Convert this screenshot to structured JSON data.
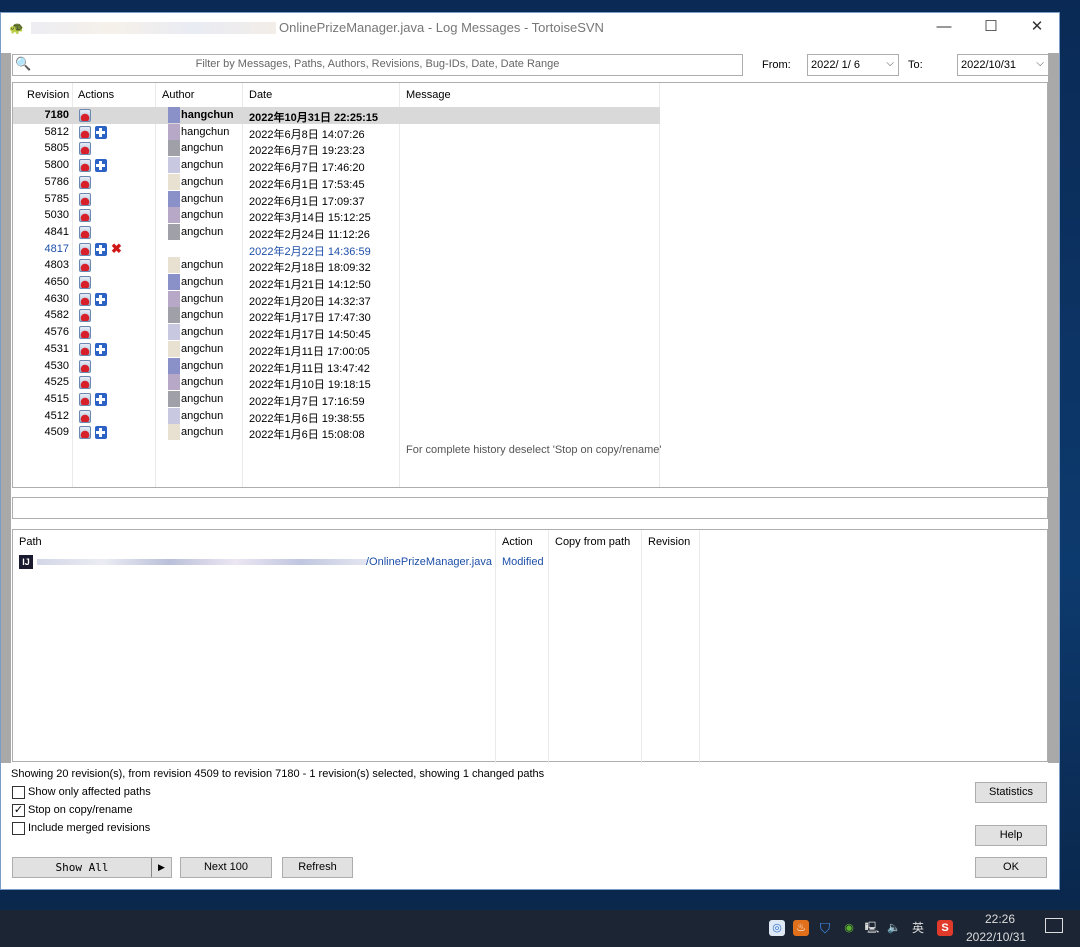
{
  "window": {
    "title": "OnlinePrizeManager.java - Log Messages - TortoiseSVN",
    "controls": {
      "minimize": "—",
      "maximize": "☐",
      "close": "✕"
    }
  },
  "filter": {
    "placeholder": "Filter by Messages, Paths, Authors, Revisions, Bug-IDs, Date, Date Range",
    "from_label": "From:",
    "from_value": "2022/ 1/ 6",
    "to_label": "To:",
    "to_value": "2022/10/31"
  },
  "log": {
    "columns": [
      "Revision",
      "Actions",
      "Author",
      "Date",
      "Message"
    ],
    "rows": [
      {
        "revision": "7180",
        "actions": [
          "modified"
        ],
        "author": "hangchun",
        "date": "2022年10月31日 22:25:15",
        "selected": true
      },
      {
        "revision": "5812",
        "actions": [
          "modified",
          "added"
        ],
        "author": "hangchun",
        "date": "2022年6月8日 14:07:26"
      },
      {
        "revision": "5805",
        "actions": [
          "modified"
        ],
        "author": "angchun",
        "date": "2022年6月7日 19:23:23"
      },
      {
        "revision": "5800",
        "actions": [
          "modified",
          "added"
        ],
        "author": "angchun",
        "date": "2022年6月7日 17:46:20"
      },
      {
        "revision": "5786",
        "actions": [
          "modified"
        ],
        "author": "angchun",
        "date": "2022年6月1日 17:53:45"
      },
      {
        "revision": "5785",
        "actions": [
          "modified"
        ],
        "author": "angchun",
        "date": "2022年6月1日 17:09:37"
      },
      {
        "revision": "5030",
        "actions": [
          "modified"
        ],
        "author": "angchun",
        "date": "2022年3月14日 15:12:25"
      },
      {
        "revision": "4841",
        "actions": [
          "modified"
        ],
        "author": "angchun",
        "date": "2022年2月24日 11:12:26"
      },
      {
        "revision": "4817",
        "actions": [
          "modified",
          "added",
          "deleted"
        ],
        "author": "",
        "date": "2022年2月22日 14:36:59",
        "highlight": true
      },
      {
        "revision": "4803",
        "actions": [
          "modified"
        ],
        "author": "angchun",
        "date": "2022年2月18日 18:09:32"
      },
      {
        "revision": "4650",
        "actions": [
          "modified"
        ],
        "author": "angchun",
        "date": "2022年1月21日 14:12:50"
      },
      {
        "revision": "4630",
        "actions": [
          "modified",
          "added"
        ],
        "author": "angchun",
        "date": "2022年1月20日 14:32:37"
      },
      {
        "revision": "4582",
        "actions": [
          "modified"
        ],
        "author": "angchun",
        "date": "2022年1月17日 17:47:30"
      },
      {
        "revision": "4576",
        "actions": [
          "modified"
        ],
        "author": "angchun",
        "date": "2022年1月17日 14:50:45"
      },
      {
        "revision": "4531",
        "actions": [
          "modified",
          "added"
        ],
        "author": "angchun",
        "date": "2022年1月11日 17:00:05"
      },
      {
        "revision": "4530",
        "actions": [
          "modified"
        ],
        "author": "angchun",
        "date": "2022年1月11日 13:47:42"
      },
      {
        "revision": "4525",
        "actions": [
          "modified"
        ],
        "author": "angchun",
        "date": "2022年1月10日 19:18:15"
      },
      {
        "revision": "4515",
        "actions": [
          "modified",
          "added"
        ],
        "author": "angchun",
        "date": "2022年1月7日 17:16:59"
      },
      {
        "revision": "4512",
        "actions": [
          "modified"
        ],
        "author": "angchun",
        "date": "2022年1月6日 19:38:55"
      },
      {
        "revision": "4509",
        "actions": [
          "modified",
          "added"
        ],
        "author": "angchun",
        "date": "2022年1月6日 15:08:08"
      }
    ],
    "note": "For complete history deselect 'Stop on copy/rename'"
  },
  "paths": {
    "columns": [
      "Path",
      "Action",
      "Copy from path",
      "Revision"
    ],
    "rows": [
      {
        "path": "/OnlinePrizeManager.java",
        "action": "Modified"
      }
    ]
  },
  "status": "Showing 20 revision(s), from revision 4509 to revision 7180 - 1 revision(s) selected, showing 1 changed paths",
  "options": [
    {
      "label": "Show only affected paths",
      "checked": false
    },
    {
      "label": "Stop on copy/rename",
      "checked": true
    },
    {
      "label": "Include merged revisions",
      "checked": false
    }
  ],
  "buttons": {
    "show_all": "Show All",
    "next": "Next 100",
    "refresh": "Refresh",
    "statistics": "Statistics",
    "help": "Help",
    "ok": "OK"
  },
  "taskbar": {
    "time": "22:26",
    "date": "2022/10/31",
    "ime": "英",
    "sogou": "S"
  },
  "colors": {
    "selected_row": "#d9d9d9",
    "highlight_text": "#1d4fa8",
    "modified_icon": "#d8202a",
    "added_icon": "#2b62c4"
  }
}
